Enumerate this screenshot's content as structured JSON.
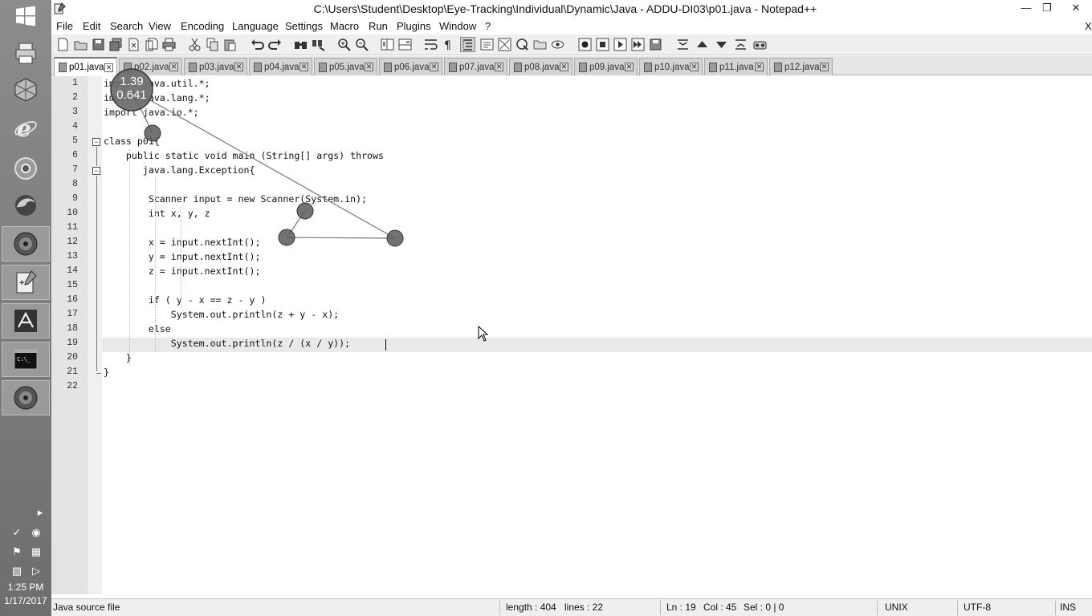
{
  "window": {
    "title": "C:\\Users\\Student\\Desktop\\Eye-Tracking\\Individual\\Dynamic\\Java - ADDU-DI03\\p01.java - Notepad++",
    "close_x": "X"
  },
  "menu": [
    "File",
    "Edit",
    "Search",
    "View",
    "Encoding",
    "Language",
    "Settings",
    "Macro",
    "Run",
    "Plugins",
    "Window",
    "?"
  ],
  "tabs": [
    "p01.java",
    "p02.java",
    "p03.java",
    "p04.java",
    "p05.java",
    "p06.java",
    "p07.java",
    "p08.java",
    "p09.java",
    "p10.java",
    "p11.java",
    "p12.java"
  ],
  "active_tab": "p01.java",
  "editor": {
    "line_numbers": [
      "1",
      "2",
      "3",
      "4",
      "5",
      "6",
      "7",
      "8",
      "9",
      "10",
      "11",
      "12",
      "13",
      "14",
      "15",
      "16",
      "17",
      "18",
      "19",
      "20",
      "21",
      "22"
    ],
    "lines": [
      "import java.util.*;",
      "import java.lang.*;",
      "import java.io.*;",
      "",
      "class p01{",
      "    public static void main (String[] args) throws",
      "       java.lang.Exception{",
      "",
      "        Scanner input = new Scanner(System.in);",
      "        int x, y, z",
      "",
      "        x = input.nextInt();",
      "        y = input.nextInt();",
      "        z = input.nextInt();",
      "",
      "        if ( y - x == z - y )",
      "            System.out.println(z + y - x);",
      "        else",
      "            System.out.println(z / (x / y));",
      "    }",
      "}",
      ""
    ],
    "current_line": 19
  },
  "gaze_overlay": {
    "big_fixation": {
      "line1": "1.39",
      "line2": "0.641"
    }
  },
  "status": {
    "file_type": "Java source file",
    "length": "length : 404",
    "lines": "lines : 22",
    "ln": "Ln : 19",
    "col": "Col : 45",
    "sel": "Sel : 0 | 0",
    "eol": "UNIX",
    "encoding": "UTF-8",
    "mode": "INS"
  },
  "taskbar": {
    "time": "1:25 PM",
    "date": "1/17/2017"
  },
  "icons": [
    "windows-start-icon",
    "printer-icon",
    "virtualbox-icon",
    "internet-explorer-icon",
    "chrome-icon",
    "firefox-icon",
    "disc-icon",
    "notepad-plus-plus-icon",
    "acrobat-icon",
    "command-prompt-icon",
    "disc-icon",
    "expand-arrow-icon",
    "tray-icon",
    "flag-icon",
    "network-icon",
    "speaker-icon"
  ]
}
